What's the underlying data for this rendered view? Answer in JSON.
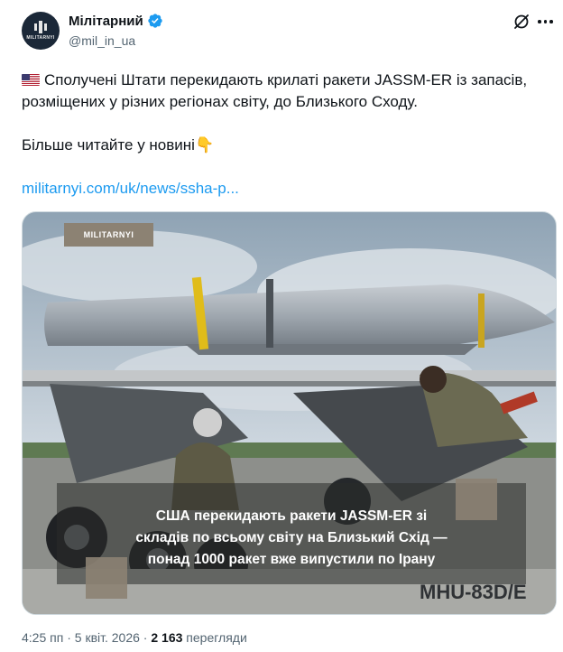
{
  "author": {
    "display_name": "Мілітарний",
    "handle": "@mil_in_ua",
    "avatar_text": "MILITARNYI"
  },
  "colors": {
    "accent": "#1d9bf0",
    "verified": "#1d9bf0",
    "watermark_bg": "#8c8273",
    "text_secondary": "#536471"
  },
  "icons": [
    "verified-badge-icon",
    "grok-icon",
    "more-icon",
    "us-flag-icon",
    "point-down-emoji-icon"
  ],
  "tweet": {
    "flag_emoji": "🇺🇸",
    "text_line1": "Сполучені Штати перекидають крилаті ракети JASSM-ER із запасів, розміщених у різних регіонах світу, до Близького Сходу.",
    "text_line2": "Більше читайте у новині",
    "emoji2": "👇",
    "link": "militarnyi.com/uk/news/ssha-p..."
  },
  "media": {
    "watermark": "MILITARNYI",
    "caption_lines": [
      "США перекидають ракети JASSM-ER зі",
      "складів по всьому світу на Близький Схід —",
      "понад 1000 ракет вже випустили по Ірану"
    ],
    "vehicle_marking": "MHU-83D/E"
  },
  "meta": {
    "time": "4:25 пп",
    "sep1": "·",
    "date": "5 квіт. 2026",
    "sep2": "·",
    "views_count": "2 163",
    "views_label": "перегляди"
  }
}
